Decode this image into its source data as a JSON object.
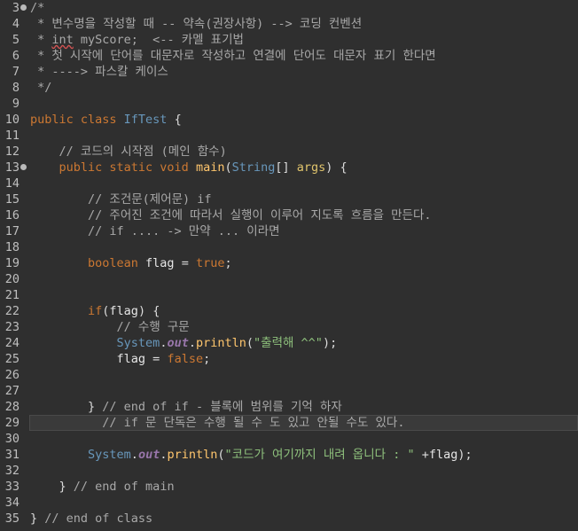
{
  "editor": {
    "lines": [
      {
        "n": "3",
        "fold": true,
        "segs": [
          {
            "c": "cm",
            "t": "/*"
          }
        ]
      },
      {
        "n": "4",
        "segs": [
          {
            "c": "cm",
            "t": " * 변수명을 작성할 때 -- 약속(권장사항) --> 코딩 컨벤션"
          }
        ]
      },
      {
        "n": "5",
        "segs": [
          {
            "c": "cm",
            "t": " * "
          },
          {
            "c": "cm squiggle",
            "t": "int"
          },
          {
            "c": "cm",
            "t": " myScore;  <-- 카멜 표기법"
          }
        ]
      },
      {
        "n": "6",
        "segs": [
          {
            "c": "cm",
            "t": " * 첫 시작에 단어를 대문자로 작성하고 연결에 단어도 대문자 표기 한다면"
          }
        ]
      },
      {
        "n": "7",
        "segs": [
          {
            "c": "cm",
            "t": " * ----> 파스칼 케이스"
          }
        ]
      },
      {
        "n": "8",
        "segs": [
          {
            "c": "cm",
            "t": " */"
          }
        ]
      },
      {
        "n": "9",
        "segs": []
      },
      {
        "n": "10",
        "segs": [
          {
            "c": "kw",
            "t": "public class "
          },
          {
            "c": "cls",
            "t": "IfTest"
          },
          {
            "c": "plain",
            "t": " {"
          }
        ]
      },
      {
        "n": "11",
        "segs": []
      },
      {
        "n": "12",
        "segs": [
          {
            "c": "cm",
            "t": "    // 코드의 시작점 (메인 함수)"
          }
        ]
      },
      {
        "n": "13",
        "fold": true,
        "segs": [
          {
            "c": "kw",
            "t": "    public static void "
          },
          {
            "c": "mtd",
            "t": "main"
          },
          {
            "c": "plain",
            "t": "("
          },
          {
            "c": "type",
            "t": "String"
          },
          {
            "c": "plain",
            "t": "[] "
          },
          {
            "c": "param",
            "t": "args"
          },
          {
            "c": "plain",
            "t": ") {"
          }
        ]
      },
      {
        "n": "14",
        "segs": []
      },
      {
        "n": "15",
        "segs": [
          {
            "c": "cm",
            "t": "        // 조건문(제어문) if"
          }
        ]
      },
      {
        "n": "16",
        "segs": [
          {
            "c": "cm",
            "t": "        // 주어진 조건에 따라서 실행이 이루어 지도록 흐름을 만든다."
          }
        ]
      },
      {
        "n": "17",
        "segs": [
          {
            "c": "cm",
            "t": "        // if .... -> 만약 ... 이라면"
          }
        ]
      },
      {
        "n": "18",
        "segs": []
      },
      {
        "n": "19",
        "segs": [
          {
            "c": "kw",
            "t": "        boolean "
          },
          {
            "c": "var",
            "t": "flag"
          },
          {
            "c": "plain",
            "t": " = "
          },
          {
            "c": "bool",
            "t": "true"
          },
          {
            "c": "plain",
            "t": ";"
          }
        ]
      },
      {
        "n": "20",
        "segs": []
      },
      {
        "n": "21",
        "segs": []
      },
      {
        "n": "22",
        "segs": [
          {
            "c": "kw",
            "t": "        if"
          },
          {
            "c": "plain",
            "t": "("
          },
          {
            "c": "var",
            "t": "flag"
          },
          {
            "c": "plain",
            "t": ") {"
          }
        ]
      },
      {
        "n": "23",
        "segs": [
          {
            "c": "cm",
            "t": "            // 수행 구문"
          }
        ]
      },
      {
        "n": "24",
        "segs": [
          {
            "c": "type",
            "t": "            System"
          },
          {
            "c": "plain",
            "t": "."
          },
          {
            "c": "fld",
            "t": "out"
          },
          {
            "c": "plain",
            "t": "."
          },
          {
            "c": "mtd",
            "t": "println"
          },
          {
            "c": "plain",
            "t": "("
          },
          {
            "c": "str",
            "t": "\"출력해 ^^\""
          },
          {
            "c": "plain",
            "t": ");"
          }
        ]
      },
      {
        "n": "25",
        "segs": [
          {
            "c": "var",
            "t": "            flag"
          },
          {
            "c": "plain",
            "t": " = "
          },
          {
            "c": "bool",
            "t": "false"
          },
          {
            "c": "plain",
            "t": ";"
          }
        ]
      },
      {
        "n": "26",
        "segs": []
      },
      {
        "n": "27",
        "segs": []
      },
      {
        "n": "28",
        "segs": [
          {
            "c": "plain",
            "t": "        } "
          },
          {
            "c": "cm",
            "t": "// end of if - 블록에 범위를 기억 하자"
          }
        ]
      },
      {
        "n": "29",
        "current": true,
        "segs": [
          {
            "c": "cm",
            "t": "          // if 문 단독은 수행 될 수 도 있고 안될 수도 있다."
          }
        ]
      },
      {
        "n": "30",
        "segs": []
      },
      {
        "n": "31",
        "segs": [
          {
            "c": "type",
            "t": "        System"
          },
          {
            "c": "plain",
            "t": "."
          },
          {
            "c": "fld",
            "t": "out"
          },
          {
            "c": "plain",
            "t": "."
          },
          {
            "c": "mtd",
            "t": "println"
          },
          {
            "c": "plain",
            "t": "("
          },
          {
            "c": "str",
            "t": "\"코드가 여기까지 내려 옵니다 : \""
          },
          {
            "c": "plain",
            "t": " +"
          },
          {
            "c": "var",
            "t": "flag"
          },
          {
            "c": "plain",
            "t": ");"
          }
        ]
      },
      {
        "n": "32",
        "segs": []
      },
      {
        "n": "33",
        "segs": [
          {
            "c": "plain",
            "t": "    } "
          },
          {
            "c": "cm",
            "t": "// end of main"
          }
        ]
      },
      {
        "n": "34",
        "segs": []
      },
      {
        "n": "35",
        "segs": [
          {
            "c": "plain",
            "t": "} "
          },
          {
            "c": "cm",
            "t": "// end of class"
          }
        ]
      }
    ]
  }
}
